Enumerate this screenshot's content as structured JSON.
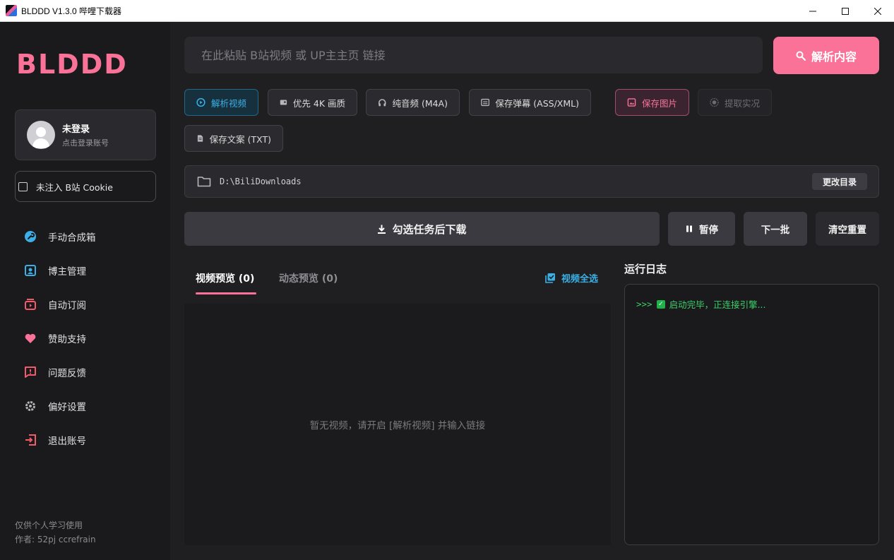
{
  "window": {
    "title": "BLDDD V1.3.0 哔哩下载器",
    "controls": {
      "minimize": "—",
      "maximize": "☐",
      "close": "✕"
    }
  },
  "sidebar": {
    "logo": "BLDDD",
    "user": {
      "name": "未登录",
      "subtitle": "点击登录账号"
    },
    "cookie_label": "未注入 B站 Cookie",
    "nav": [
      {
        "label": "手动合成箱",
        "icon": "wrench-icon",
        "color": "#3ab0e6"
      },
      {
        "label": "博主管理",
        "icon": "contact-card-icon",
        "color": "#3ab0e6"
      },
      {
        "label": "自动订阅",
        "icon": "subscription-icon",
        "color": "#f25c6a"
      },
      {
        "label": "赞助支持",
        "icon": "heart-icon",
        "color": "#fb7299"
      },
      {
        "label": "问题反馈",
        "icon": "feedback-icon",
        "color": "#f25c6a"
      },
      {
        "label": "偏好设置",
        "icon": "gear-icon",
        "color": "#b0b0b6"
      },
      {
        "label": "退出账号",
        "icon": "logout-icon",
        "color": "#f25c6a"
      }
    ],
    "footer": [
      "仅供个人学习使用",
      "作者: 52pj ccrefrain"
    ]
  },
  "search": {
    "placeholder": "在此粘贴 B站视频 或 UP主主页 链接",
    "value": ""
  },
  "parse_button": "解析内容",
  "options": [
    {
      "label": "解析视频",
      "state": "active-blue",
      "icon": "play-circle-icon"
    },
    {
      "label": "优先 4K 画质",
      "state": "normal",
      "icon": "4k-icon"
    },
    {
      "label": "纯音频 (M4A)",
      "state": "normal",
      "icon": "headphones-icon"
    },
    {
      "label": "保存弹幕 (ASS/XML)",
      "state": "normal",
      "icon": "subtitles-icon"
    },
    {
      "label": "保存图片",
      "state": "active-pink",
      "icon": "image-icon"
    },
    {
      "label": "提取实况",
      "state": "disabled",
      "icon": "live-photo-icon"
    },
    {
      "label": "保存文案 (TXT)",
      "state": "normal",
      "icon": "document-icon"
    }
  ],
  "download_dir": {
    "path": "D:\\BiliDownloads",
    "change_label": "更改目录"
  },
  "actions": {
    "download": "勾选任务后下载",
    "pause": "暂停",
    "next_batch": "下一批",
    "reset": "清空重置"
  },
  "tabs": [
    {
      "label": "视频预览 (0)",
      "active": true
    },
    {
      "label": "动态预览 (0)",
      "active": false
    }
  ],
  "select_all": "视频全选",
  "empty_message": "暂无视频，请开启 [解析视频] 并输入链接",
  "log": {
    "title": "运行日志",
    "lines": [
      {
        "prefix": ">>>",
        "text": "启动完毕，正连接引擎..."
      }
    ]
  }
}
